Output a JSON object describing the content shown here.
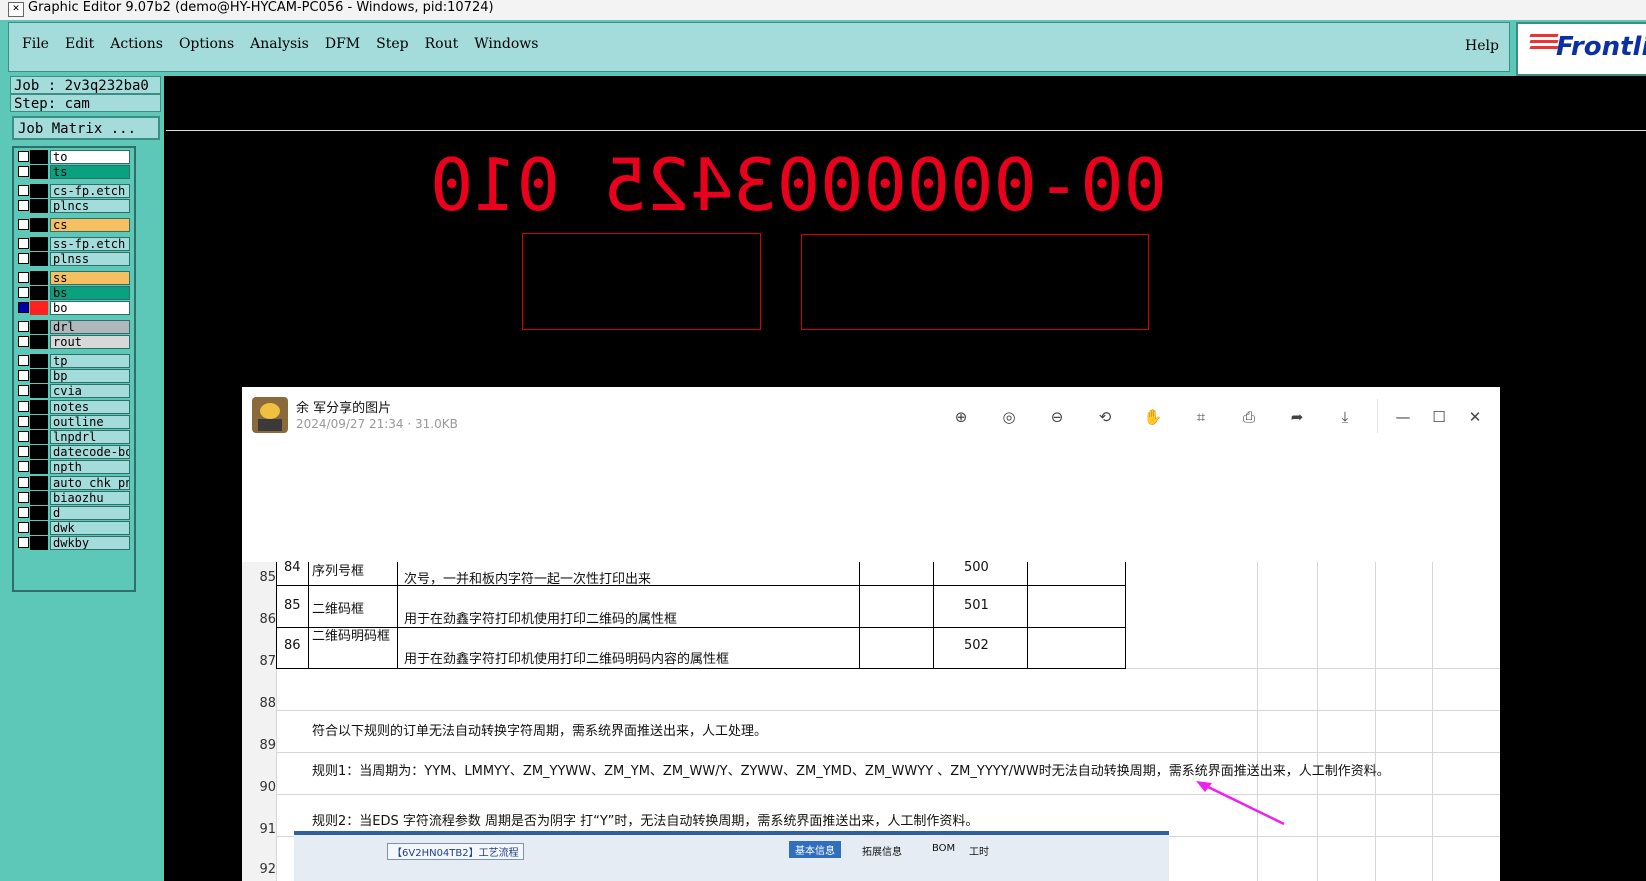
{
  "window": {
    "title": "Graphic Editor 9.07b2 (demo@HY-HYCAM-PC056 - Windows, pid:10724)"
  },
  "menu": {
    "items": [
      "File",
      "Edit",
      "Actions",
      "Options",
      "Analysis",
      "DFM",
      "Step",
      "Rout",
      "Windows"
    ],
    "help": "Help"
  },
  "brand": {
    "logo_text": "Frontline",
    "logo_color": "#0b2fa5",
    "accent_color": "#e33333"
  },
  "job": {
    "job_label": "Job : 2v3q232ba0",
    "step_label": "Step: cam",
    "matrix_button": "Job Matrix ..."
  },
  "layers": [
    {
      "name": "to",
      "color": "#ffffff"
    },
    {
      "name": "ts",
      "color": "#0aa27e"
    },
    {
      "name": "cs-fp.etch",
      "color": "#a3dcdb"
    },
    {
      "name": "plncs",
      "color": "#a3dcdb"
    },
    {
      "name": "cs",
      "color": "#f6c060"
    },
    {
      "name": "ss-fp.etch",
      "color": "#a3dcdb"
    },
    {
      "name": "plnss",
      "color": "#a3dcdb"
    },
    {
      "name": "ss",
      "color": "#f6c060"
    },
    {
      "name": "bs",
      "color": "#0aa27e"
    },
    {
      "name": "bo",
      "color": "#ffffff"
    },
    {
      "name": "drl",
      "color": "#b0b8bc"
    },
    {
      "name": "rout",
      "color": "#d8d8d8"
    },
    {
      "name": "tp",
      "color": "#a3dcdb"
    },
    {
      "name": "bp",
      "color": "#a3dcdb"
    },
    {
      "name": "cvia",
      "color": "#a3dcdb"
    },
    {
      "name": "notes",
      "color": "#a3dcdb"
    },
    {
      "name": "outline",
      "color": "#a3dcdb"
    },
    {
      "name": "lnpdrl",
      "color": "#a3dcdb"
    },
    {
      "name": "datecode-bo",
      "color": "#a3dcdb"
    },
    {
      "name": "npth",
      "color": "#a3dcdb"
    },
    {
      "name": "auto_chk_pnl",
      "color": "#a3dcdb"
    },
    {
      "name": "biaozhu",
      "color": "#a3dcdb"
    },
    {
      "name": "d",
      "color": "#a3dcdb"
    },
    {
      "name": "dwk",
      "color": "#a3dcdb"
    },
    {
      "name": "dwkby",
      "color": "#a3dcdb"
    }
  ],
  "canvas": {
    "text": "00-0000003425 010",
    "text_color": "#e8001c"
  },
  "viewer": {
    "title": "余 军分享的图片",
    "meta": "2024/09/27 21:34 · 31.0KB",
    "toolbar_icons": [
      "zoom-in-icon",
      "actual-size-icon",
      "zoom-out-icon",
      "rotate-icon",
      "hand-icon",
      "ocr-icon",
      "print-icon",
      "share-icon",
      "download-icon"
    ],
    "window_icons": [
      "minimize-icon",
      "maximize-icon",
      "close-icon"
    ]
  },
  "sheet": {
    "row_numbers": [
      "85",
      "86",
      "87",
      "88",
      "89",
      "90",
      "91",
      "92"
    ],
    "rows": [
      {
        "id": "84",
        "name": "序列号框",
        "desc": "次号，一并和板内字符一起一次性打印出来",
        "code": "500"
      },
      {
        "id": "85",
        "name": "二维码框",
        "desc": "用于在劲鑫字符打印机使用打印二维码的属性框",
        "code": "501"
      },
      {
        "id": "86",
        "name": "二维码明码框",
        "desc": "用于在劲鑫字符打印机使用打印二维码明码内容的属性框",
        "code": "502"
      }
    ],
    "note": "符合以下规则的订单无法自动转换字符周期，需系统界面推送出来，人工处理。",
    "rule1": "规则1：当周期为：YYM、LMMYY、ZM_YYWW、ZM_YM、ZM_WW/Y、ZYWW、ZM_YMD、ZM_WWYY 、ZM_YYYY/WW时无法自动转换周期，需系统界面推送出来，人工制作资料。",
    "rule2": "规则2：当EDS 字符流程参数  周期是否为阴字  打“Y”时，无法自动转换周期，需系统界面推送出来，人工制作资料。"
  },
  "taskbar": {
    "item": "【6V2HN04TB2】工艺流程",
    "tabs": [
      "基本信息",
      "拓展信息",
      "BOM",
      "工时"
    ]
  }
}
